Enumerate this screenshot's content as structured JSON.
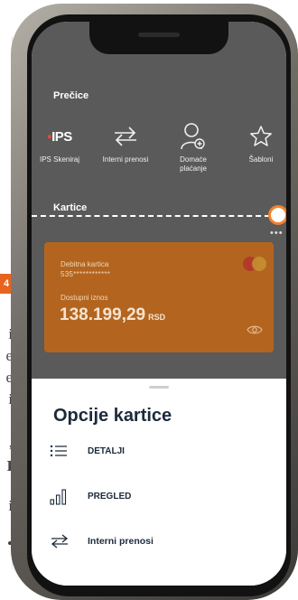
{
  "background_article": {
    "tag": "4",
    "fragments": [
      "i",
      "e",
      "e",
      "i",
      ",",
      "I",
      "i",
      "•"
    ]
  },
  "app": {
    "shortcuts_title": "Prečice",
    "shortcuts": [
      {
        "icon": "ips-icon",
        "label": "IPS Skeniraj",
        "icon_text": "IPS"
      },
      {
        "icon": "transfer-arrows-icon",
        "label": "Interni prenosi"
      },
      {
        "icon": "user-add-icon",
        "label": "Domaće plaćanje"
      },
      {
        "icon": "star-icon",
        "label": "Šabloni"
      }
    ],
    "cards_title": "Kartice",
    "more_label": "•••",
    "card": {
      "name": "Debitna kartica",
      "number": "535************",
      "balance_label": "Dostupni iznos",
      "balance": "138.199,29",
      "currency": "RSD",
      "brand_icon": "mastercard-icon",
      "visibility_icon": "eye-icon"
    }
  },
  "sheet": {
    "title": "Opcije kartice",
    "options": [
      {
        "icon": "list-icon",
        "label": "DETALJI"
      },
      {
        "icon": "bar-chart-icon",
        "label": "PREGLED"
      },
      {
        "icon": "transfer-arrows-icon",
        "label": "Interni prenosi"
      }
    ]
  },
  "colors": {
    "overlay": "#5a5a5a",
    "card": "#b3651f",
    "accent": "#f2822e",
    "text_dark": "#1c2a3a"
  }
}
